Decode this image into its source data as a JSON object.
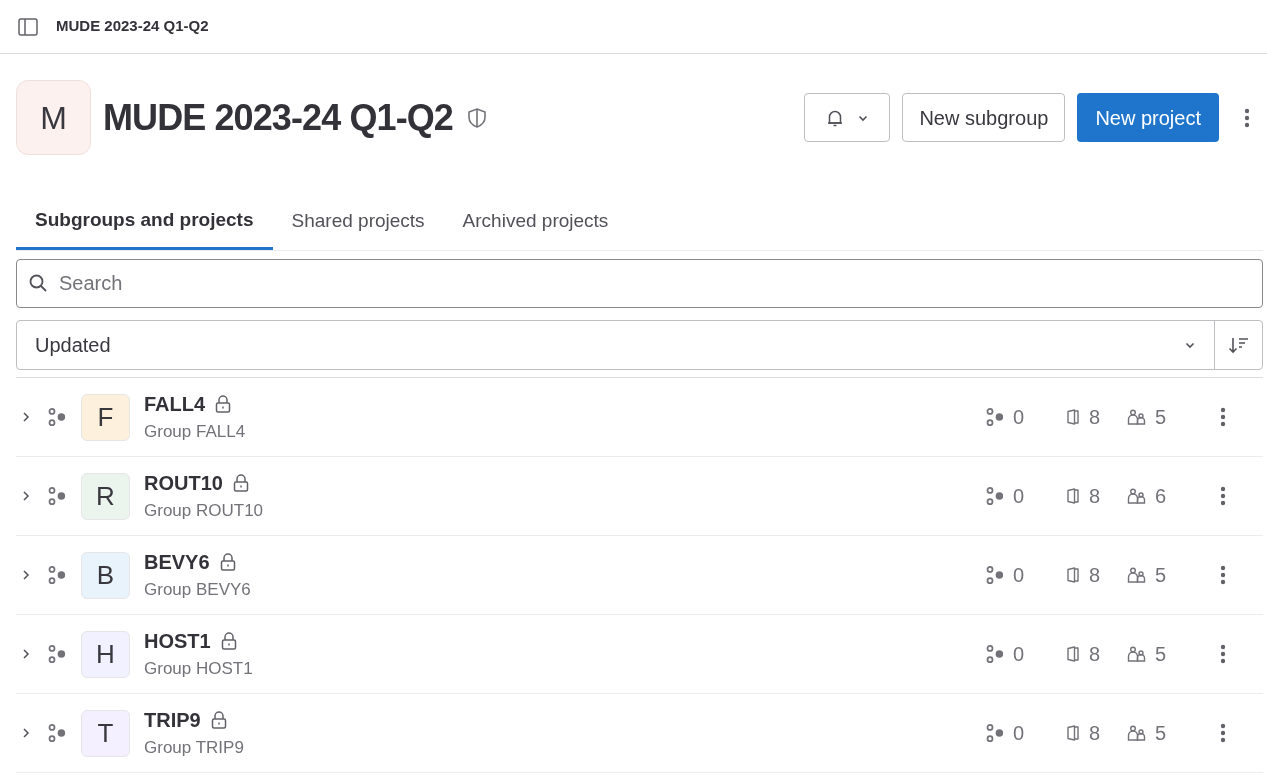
{
  "breadcrumb": "MUDE 2023-24 Q1-Q2",
  "group": {
    "avatar": "M",
    "title": "MUDE 2023-24 Q1-Q2"
  },
  "actions": {
    "new_subgroup": "New subgroup",
    "new_project": "New project"
  },
  "tabs": [
    {
      "label": "Subgroups and projects",
      "selected": true
    },
    {
      "label": "Shared projects",
      "selected": false
    },
    {
      "label": "Archived projects",
      "selected": false
    }
  ],
  "search": {
    "placeholder": "Search"
  },
  "sort": {
    "value": "Updated"
  },
  "rows": [
    {
      "avatar": "F",
      "color": "#fdf1dd",
      "name": "FALL4",
      "description": "Group FALL4",
      "subgroups": "0",
      "projects": "8",
      "members": "5"
    },
    {
      "avatar": "R",
      "color": "#ecf4ee",
      "name": "ROUT10",
      "description": "Group ROUT10",
      "subgroups": "0",
      "projects": "8",
      "members": "6"
    },
    {
      "avatar": "B",
      "color": "#e9f3fc",
      "name": "BEVY6",
      "description": "Group BEVY6",
      "subgroups": "0",
      "projects": "8",
      "members": "5"
    },
    {
      "avatar": "H",
      "color": "#f1f1ff",
      "name": "HOST1",
      "description": "Group HOST1",
      "subgroups": "0",
      "projects": "8",
      "members": "5"
    },
    {
      "avatar": "T",
      "color": "#f4f0ff",
      "name": "TRIP9",
      "description": "Group TRIP9",
      "subgroups": "0",
      "projects": "8",
      "members": "5"
    }
  ]
}
